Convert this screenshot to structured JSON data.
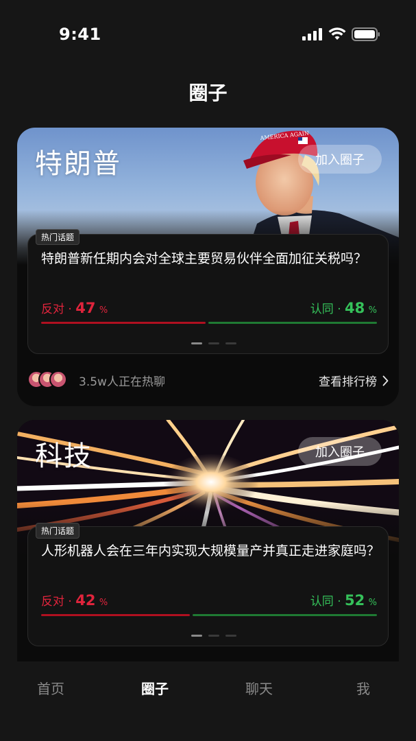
{
  "status_bar": {
    "time": "9:41"
  },
  "page": {
    "title": "圈子"
  },
  "cards": [
    {
      "name": "特朗普",
      "join_label": "加入圈子",
      "tag": "热门话题",
      "question": "特朗普新任期内会对全球主要贸易伙伴全面加征关税吗？",
      "against_label": "反对",
      "against_value": "47",
      "agree_label": "认同",
      "agree_value": "48",
      "pct_sign": "%",
      "against_share": 0.47,
      "agree_share": 0.48,
      "online_text": "3.5w人正在热聊",
      "rank_label": "查看排行榜",
      "hat_text": "AMERICA AGAIN"
    },
    {
      "name": "科技",
      "join_label": "加入圈子",
      "tag": "热门话题",
      "question": "人形机器人会在三年内实现大规模量产并真正走进家庭吗？",
      "against_label": "反对",
      "against_value": "42",
      "agree_label": "认同",
      "agree_value": "52",
      "pct_sign": "%",
      "against_share": 0.42,
      "agree_share": 0.52
    }
  ],
  "tabs": [
    {
      "label": "首页",
      "active": false
    },
    {
      "label": "圈子",
      "active": true
    },
    {
      "label": "聊天",
      "active": false
    },
    {
      "label": "我",
      "active": false
    }
  ],
  "colors": {
    "against": "#e0243c",
    "agree": "#35c15a",
    "background": "#161616"
  }
}
